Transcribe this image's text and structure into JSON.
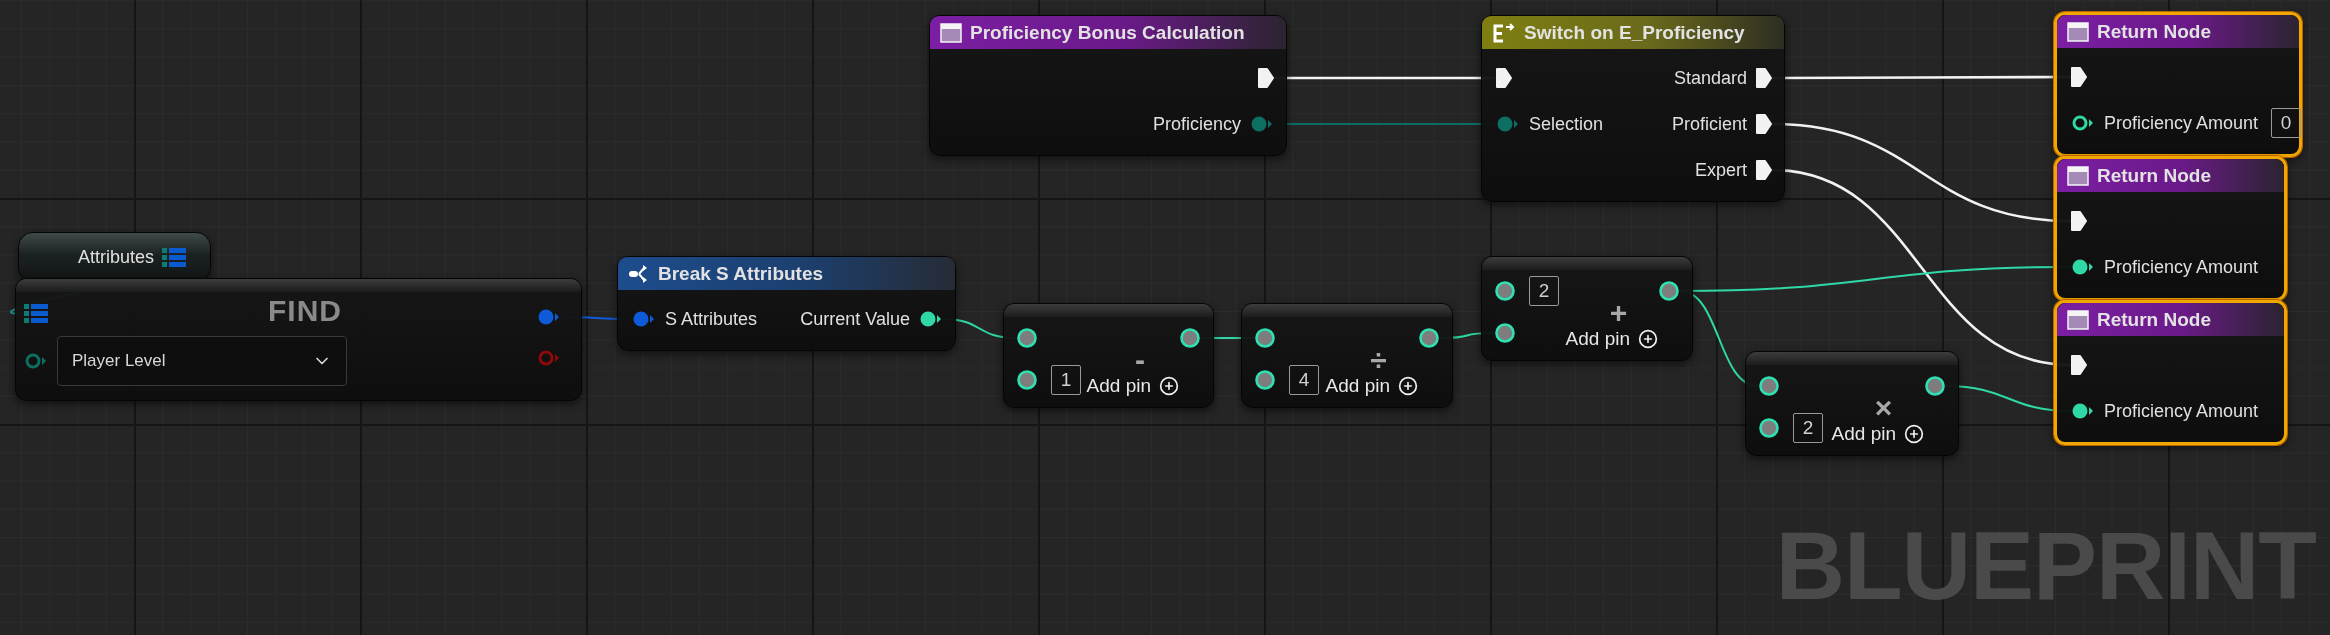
{
  "nodes": [
    {
      "kind": "function_entry",
      "title": "Proficiency Bonus Calculation",
      "selected": false,
      "outputs": [
        {
          "kind": "exec",
          "connected": true
        },
        {
          "kind": "enum",
          "label": "Proficiency",
          "connected": true
        }
      ]
    },
    {
      "kind": "switch",
      "title": "Switch on E_Proficiency",
      "selected": false,
      "inputs": [
        {
          "kind": "exec",
          "connected": true
        },
        {
          "kind": "enum",
          "label": "Selection",
          "connected": true
        }
      ],
      "outputs": [
        {
          "kind": "exec",
          "label": "Standard",
          "connected": true
        },
        {
          "kind": "exec",
          "label": "Proficient",
          "connected": true
        },
        {
          "kind": "exec",
          "label": "Expert",
          "connected": true
        }
      ]
    },
    {
      "kind": "return",
      "title": "Return Node",
      "selected": true,
      "inputs": [
        {
          "kind": "exec",
          "connected": true
        },
        {
          "kind": "float",
          "label": "Proficiency Amount",
          "connected": false,
          "value": "0"
        }
      ]
    },
    {
      "kind": "return",
      "title": "Return Node",
      "selected": true,
      "inputs": [
        {
          "kind": "exec",
          "connected": true
        },
        {
          "kind": "float",
          "label": "Proficiency Amount",
          "connected": true
        }
      ]
    },
    {
      "kind": "return",
      "title": "Return Node",
      "selected": true,
      "inputs": [
        {
          "kind": "exec",
          "connected": true
        },
        {
          "kind": "float",
          "label": "Proficiency Amount",
          "connected": true
        }
      ]
    },
    {
      "kind": "variable",
      "title": "Attributes",
      "selected": false,
      "outputs": [
        {
          "kind": "map",
          "connected": true
        }
      ]
    },
    {
      "kind": "find",
      "title": "FIND",
      "selected": false,
      "inputs": [
        {
          "kind": "map",
          "connected": true
        },
        {
          "kind": "enum",
          "connected": false,
          "dropdown": "Player Level"
        }
      ],
      "outputs": [
        {
          "kind": "struct",
          "connected": true
        },
        {
          "kind": "bool",
          "connected": false
        }
      ]
    },
    {
      "kind": "break",
      "title": "Break S Attributes",
      "selected": false,
      "inputs": [
        {
          "kind": "struct",
          "label": "S Attributes",
          "connected": true
        }
      ],
      "outputs": [
        {
          "kind": "float",
          "label": "Current Value",
          "connected": true
        }
      ]
    },
    {
      "kind": "math",
      "symbol": "-",
      "add_pin": "Add pin",
      "selected": false,
      "inputs": [
        {
          "kind": "float"
        },
        {
          "kind": "float",
          "value": "1"
        }
      ],
      "outputs": [
        {
          "kind": "float"
        }
      ]
    },
    {
      "kind": "math",
      "symbol": "÷",
      "add_pin": "Add pin",
      "selected": false,
      "inputs": [
        {
          "kind": "float"
        },
        {
          "kind": "float",
          "value": "4"
        }
      ],
      "outputs": [
        {
          "kind": "float"
        }
      ]
    },
    {
      "kind": "math",
      "symbol": "+",
      "add_pin": "Add pin",
      "selected": false,
      "inputs": [
        {
          "kind": "float",
          "value": "2"
        },
        {
          "kind": "float"
        }
      ],
      "outputs": [
        {
          "kind": "float"
        }
      ]
    },
    {
      "kind": "math",
      "symbol": "×",
      "add_pin": "Add pin",
      "selected": false,
      "inputs": [
        {
          "kind": "float"
        },
        {
          "kind": "float",
          "value": "2"
        }
      ],
      "outputs": [
        {
          "kind": "float"
        }
      ]
    }
  ],
  "graph_label": "BLUEPRINT"
}
